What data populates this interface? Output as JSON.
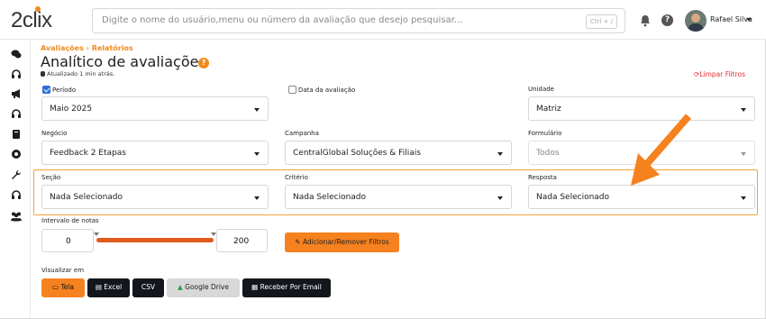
{
  "topbar": {
    "logo": "2clix",
    "search_placeholder": "Digite o nome do usuário,menu ou número da avaliação que desejo pesquisar...",
    "search_shortcut": "Ctrl + /",
    "help_glyph": "?",
    "user_name": "Rafael Silva"
  },
  "sidebar": {
    "icons": [
      "chat-icon",
      "headset-icon",
      "megaphone-icon",
      "headset-icon",
      "book-icon",
      "cog-badge-icon",
      "wrench-icon",
      "headset-icon",
      "users-icon"
    ]
  },
  "page": {
    "breadcrumb": "Avaliações  ›  Relatórios",
    "title": "Analítico de avaliações",
    "help_glyph": "?",
    "updated": "Atualizado 1 min atrás.",
    "clear_filters": "Limpar Filtros",
    "clear_icon": "refresh-icon"
  },
  "filters": {
    "periodo_label": "Período",
    "periodo_checked": true,
    "data_avaliacao_label": "Data da avaliação",
    "data_avaliacao_checked": false,
    "periodo_value": "Maio 2025",
    "unidade_label": "Unidade",
    "unidade_value": "Matriz",
    "negocio_label": "Negócio",
    "negocio_value": "Feedback 2 Etapas",
    "campanha_label": "Campanha",
    "campanha_value": "CentralGlobal Soluções & Filiais",
    "formulario_label": "Formulário",
    "formulario_value": "Todos",
    "secao_label": "Seção",
    "secao_value": "Nada Selecionado",
    "criterio_label": "Critério",
    "criterio_value": "Nada Selecionado",
    "resposta_label": "Resposta",
    "resposta_value": "Nada Selecionado",
    "intervalo_label": "Intervalo de notas",
    "intervalo_min": "0",
    "intervalo_max": "200",
    "add_remove_label": "Adicionar/Remover Filtros"
  },
  "visualizar": {
    "label": "Visualizar em",
    "buttons": [
      "Tela",
      "Excel",
      "CSV",
      "Google Drive",
      "Receber Por Email"
    ]
  },
  "colors": {
    "accent": "#f6811f",
    "dark": "#13161c",
    "danger": "#e03030"
  }
}
